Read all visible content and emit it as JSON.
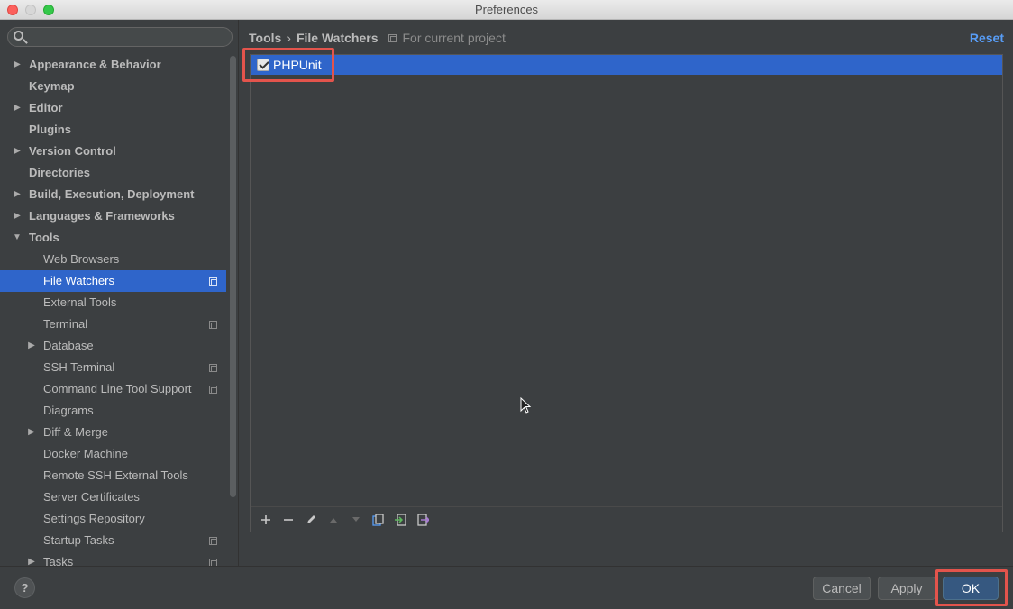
{
  "window": {
    "title": "Preferences"
  },
  "search": {
    "placeholder": ""
  },
  "sidebar": {
    "items": [
      {
        "label": "Appearance & Behavior",
        "level": 0,
        "expander": "▶"
      },
      {
        "label": "Keymap",
        "level": 0,
        "expander": ""
      },
      {
        "label": "Editor",
        "level": 0,
        "expander": "▶"
      },
      {
        "label": "Plugins",
        "level": 0,
        "expander": ""
      },
      {
        "label": "Version Control",
        "level": 0,
        "expander": "▶"
      },
      {
        "label": "Directories",
        "level": 0,
        "expander": ""
      },
      {
        "label": "Build, Execution, Deployment",
        "level": 0,
        "expander": "▶"
      },
      {
        "label": "Languages & Frameworks",
        "level": 0,
        "expander": "▶"
      },
      {
        "label": "Tools",
        "level": 0,
        "expander": "▼"
      },
      {
        "label": "Web Browsers",
        "level": 1,
        "expander": ""
      },
      {
        "label": "File Watchers",
        "level": 1,
        "expander": "",
        "selected": true,
        "project_icon": true
      },
      {
        "label": "External Tools",
        "level": 1,
        "expander": ""
      },
      {
        "label": "Terminal",
        "level": 1,
        "expander": "",
        "project_icon": true
      },
      {
        "label": "Database",
        "level": 1,
        "expander": "▶"
      },
      {
        "label": "SSH Terminal",
        "level": 1,
        "expander": "",
        "project_icon": true
      },
      {
        "label": "Command Line Tool Support",
        "level": 1,
        "expander": "",
        "project_icon": true
      },
      {
        "label": "Diagrams",
        "level": 1,
        "expander": ""
      },
      {
        "label": "Diff & Merge",
        "level": 1,
        "expander": "▶"
      },
      {
        "label": "Docker Machine",
        "level": 1,
        "expander": ""
      },
      {
        "label": "Remote SSH External Tools",
        "level": 1,
        "expander": ""
      },
      {
        "label": "Server Certificates",
        "level": 1,
        "expander": ""
      },
      {
        "label": "Settings Repository",
        "level": 1,
        "expander": ""
      },
      {
        "label": "Startup Tasks",
        "level": 1,
        "expander": "",
        "project_icon": true
      },
      {
        "label": "Tasks",
        "level": 1,
        "expander": "▶",
        "project_icon": true
      }
    ]
  },
  "main": {
    "breadcrumb": {
      "parent": "Tools",
      "separator": "›",
      "current": "File Watchers",
      "scope": "For current project"
    },
    "reset_label": "Reset",
    "watchers": [
      {
        "name": "PHPUnit",
        "enabled": true
      }
    ],
    "toolbar_icons": [
      "add-icon",
      "remove-icon",
      "edit-icon",
      "move-up-icon",
      "move-down-icon",
      "copy-icon",
      "import-icon",
      "export-icon"
    ],
    "highlight_color": "#e3544c"
  },
  "footer": {
    "help_label": "?",
    "cancel_label": "Cancel",
    "apply_label": "Apply",
    "ok_label": "OK"
  },
  "colors": {
    "background": "#3c3f41",
    "selection": "#2f65ca",
    "link": "#589df6",
    "default_button": "#365880"
  }
}
